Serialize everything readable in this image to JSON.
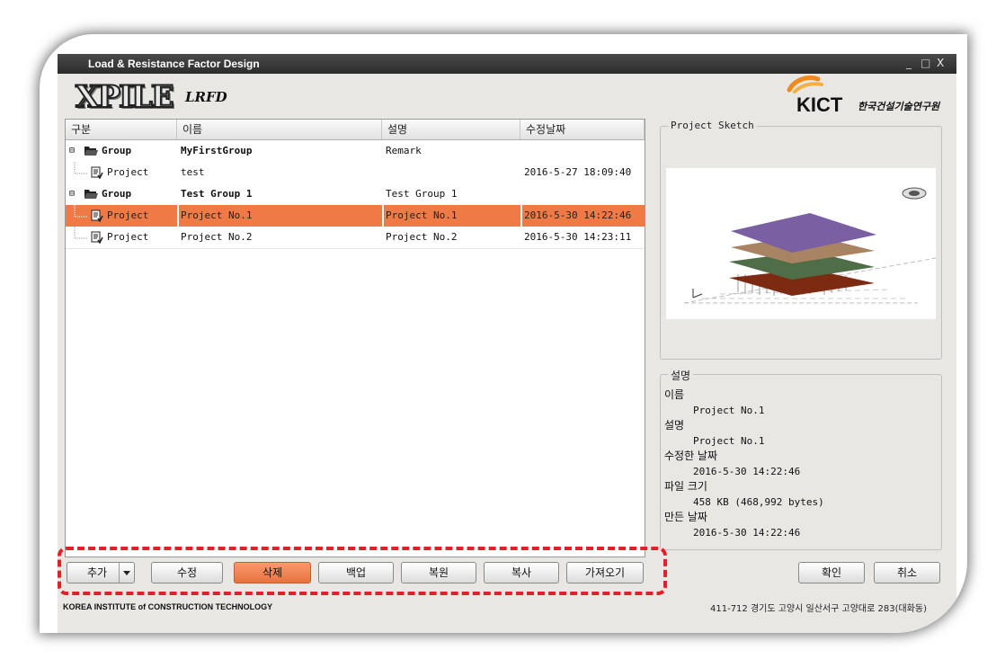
{
  "window": {
    "title": "Load & Resistance Factor Design",
    "minimize": "_",
    "maximize": "□",
    "close": "X"
  },
  "branding": {
    "logo_text": "XPILE",
    "logo_sub": "LRFD",
    "kict": "KICT",
    "kict_korean": "한국건설기술연구원"
  },
  "table": {
    "columns": [
      "구분",
      "이름",
      "설명",
      "수정날짜"
    ],
    "rows": [
      {
        "type": "Group",
        "name": "MyFirstGroup",
        "desc": "Remark",
        "date": "",
        "level": 0,
        "expanded": "⊟"
      },
      {
        "type": "Project",
        "name": "test",
        "desc": "",
        "date": "2016-5-27 18:09:40",
        "level": 1
      },
      {
        "type": "Group",
        "name": "Test Group 1",
        "desc": "Test Group 1",
        "date": "",
        "level": 0,
        "expanded": "⊟"
      },
      {
        "type": "Project",
        "name": "Project No.1",
        "desc": "Project No.1",
        "date": "2016-5-30 14:22:46",
        "level": 1,
        "selected": true
      },
      {
        "type": "Project",
        "name": "Project No.2",
        "desc": "Project No.2",
        "date": "2016-5-30 14:23:11",
        "level": 1
      }
    ]
  },
  "sketch": {
    "title": "Project Sketch"
  },
  "info": {
    "title": "설명",
    "name_label": "이름",
    "name_value": "Project No.1",
    "desc_label": "설명",
    "desc_value": "Project No.1",
    "modified_label": "수정한 날짜",
    "modified_value": "2016-5-30 14:22:46",
    "size_label": "파일 크기",
    "size_value": "458 KB (468,992 bytes)",
    "created_label": "만든 날짜",
    "created_value": "2016-5-30 14:22:46"
  },
  "buttons": {
    "add": "추가",
    "edit": "수정",
    "delete": "삭제",
    "backup": "백업",
    "restore": "복원",
    "copy": "복사",
    "import": "가져오기",
    "ok": "확인",
    "cancel": "취소"
  },
  "footer": {
    "left": "KOREA INSTITUTE of CONSTRUCTION TECHNOLOGY",
    "right": "411-712 경기도 고양시 일산서구 고양대로 283(대화동)"
  },
  "colors": {
    "selected": "#ef7a45",
    "dashed_border": "#e0202b",
    "layer_purple": "#7b5fa3",
    "layer_tan": "#a88462",
    "layer_green": "#4f6e47",
    "layer_brown": "#7d2a12"
  }
}
